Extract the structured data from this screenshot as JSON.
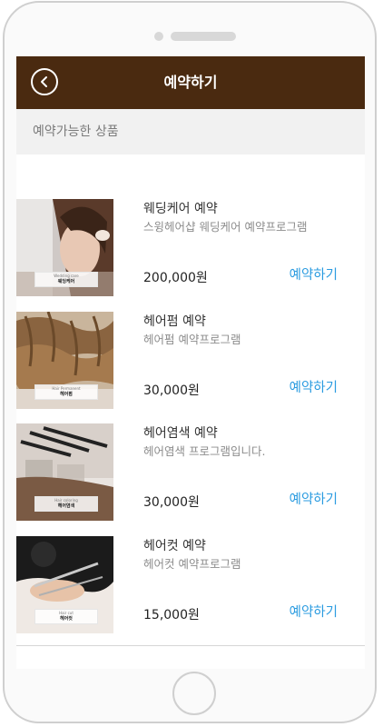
{
  "header": {
    "title": "예약하기"
  },
  "section": {
    "label": "예약가능한 상품"
  },
  "products": [
    {
      "title": "웨딩케어 예약",
      "description": "스윙헤어샵 웨딩케어 예약프로그램",
      "price": "200,000원",
      "book_label": "예약하기",
      "thumb_en": "Wedding care",
      "thumb_ko": "웨딩케어"
    },
    {
      "title": "헤어펌 예약",
      "description": "헤어펌 예약프로그램",
      "price": "30,000원",
      "book_label": "예약하기",
      "thumb_en": "Hair Permanent",
      "thumb_ko": "헤어펌"
    },
    {
      "title": "헤어염색 예약",
      "description": "헤어염색 프로그램입니다.",
      "price": "30,000원",
      "book_label": "예약하기",
      "thumb_en": "Hair coloring",
      "thumb_ko": "헤어염색"
    },
    {
      "title": "헤어컷 예약",
      "description": "헤어컷 예약프로그램",
      "price": "15,000원",
      "book_label": "예약하기",
      "thumb_en": "Hair cut",
      "thumb_ko": "헤어컷"
    }
  ],
  "icons": {
    "back": "chevron-left-circle-icon"
  },
  "colors": {
    "header_bg": "#4a2a10",
    "accent": "#2a9be0",
    "section_bg": "#f1f1f1"
  }
}
